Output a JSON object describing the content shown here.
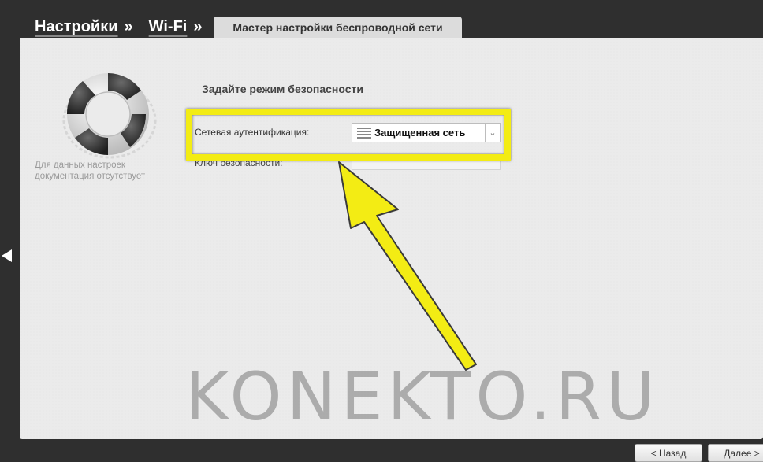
{
  "breadcrumb": {
    "items": [
      "Настройки",
      "Wi-Fi"
    ],
    "separator": "»"
  },
  "tab": {
    "label": "Мастер настройки беспроводной сети"
  },
  "help": {
    "text": "Для данных настроек документация отсутствует"
  },
  "section": {
    "title": "Задайте режим безопасности"
  },
  "form": {
    "auth_label": "Сетевая аутентификация:",
    "auth_value": "Защищенная сеть",
    "key_label": "Ключ безопасности:"
  },
  "buttons": {
    "back": "< Назад",
    "next": "Далее >"
  },
  "watermark": "KONEKTO.RU",
  "colors": {
    "highlight": "#f3ec14",
    "background": "#2f2f2f",
    "panel": "#ebebeb"
  },
  "icons": {
    "help": "lifebuoy-icon",
    "nav_left": "left-arrow-icon",
    "select_list": "list-icon",
    "select_arrow": "chevron-down-icon"
  }
}
